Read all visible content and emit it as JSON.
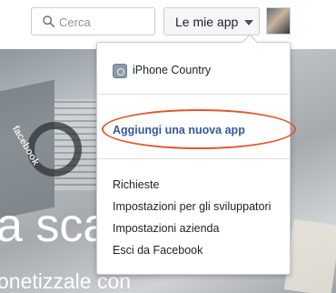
{
  "search": {
    "placeholder": "Cerca",
    "icon": "search-icon"
  },
  "header": {
    "apps_label": "Le mie app",
    "caret_icon": "caret-down-icon",
    "avatar_icon": "user-avatar"
  },
  "hero": {
    "line1": "a sca",
    "line2": "onetizzale con",
    "sticker": "facebook"
  },
  "dropdown": {
    "app": {
      "name": "iPhone Country",
      "icon": "app-gear-icon"
    },
    "add_app_label": "Aggiungi una nuova app",
    "items": [
      {
        "label": "Richieste"
      },
      {
        "label": "Impostazioni per gli sviluppatori"
      },
      {
        "label": "Impostazioni azienda"
      },
      {
        "label": "Esci da Facebook"
      }
    ]
  },
  "colors": {
    "link": "#365899",
    "highlight_ring": "#e0592a",
    "text": "#1d2129",
    "border": "#c9ccd1"
  }
}
